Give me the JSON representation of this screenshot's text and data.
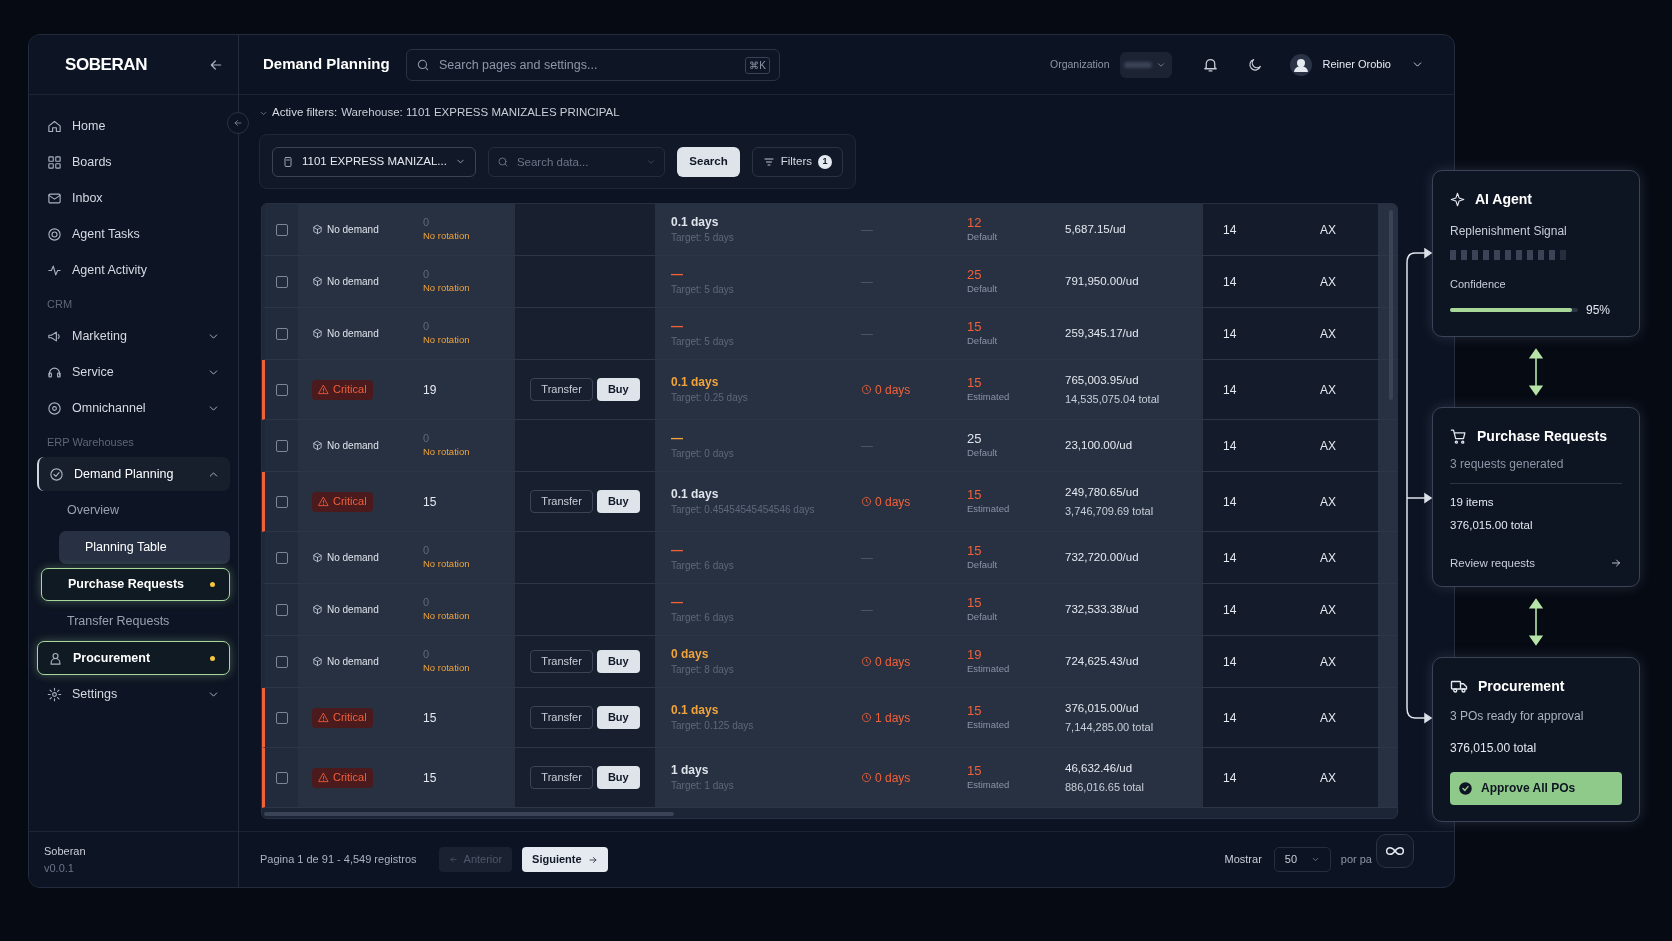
{
  "sidebar": {
    "logo": "SOBERAN",
    "nav": [
      {
        "kind": "item",
        "label": "Home",
        "selected": false,
        "active": false,
        "highlighted": false
      },
      {
        "kind": "item",
        "label": "Boards",
        "selected": false,
        "active": false,
        "highlighted": false
      },
      {
        "kind": "item",
        "label": "Inbox",
        "selected": false,
        "active": false,
        "highlighted": false
      },
      {
        "kind": "item",
        "label": "Agent Tasks",
        "selected": false,
        "active": false,
        "highlighted": false
      },
      {
        "kind": "item",
        "label": "Agent Activity",
        "selected": false,
        "active": false,
        "highlighted": false
      },
      {
        "kind": "section",
        "label": "CRM"
      },
      {
        "kind": "item",
        "label": "Marketing",
        "selected": false,
        "active": false,
        "highlighted": false,
        "expanded": false
      },
      {
        "kind": "item",
        "label": "Service",
        "selected": false,
        "active": false,
        "highlighted": false,
        "expanded": false
      },
      {
        "kind": "item",
        "label": "Omnichannel",
        "selected": false,
        "active": false,
        "highlighted": false,
        "expanded": false
      },
      {
        "kind": "section",
        "label": "ERP Warehouses"
      },
      {
        "kind": "item",
        "label": "Demand Planning",
        "selected": false,
        "active": true,
        "highlighted": false,
        "expanded": true
      },
      {
        "kind": "subitem",
        "label": "Overview",
        "selected": false,
        "active": false,
        "highlighted": false
      },
      {
        "kind": "subitem",
        "label": "Planning Table",
        "selected": true,
        "active": false,
        "highlighted": false
      },
      {
        "kind": "subitem",
        "label": "Purchase Requests",
        "selected": false,
        "active": false,
        "highlighted": true
      },
      {
        "kind": "subitem",
        "label": "Transfer Requests",
        "selected": false,
        "active": false,
        "highlighted": false
      },
      {
        "kind": "item",
        "label": "Procurement",
        "selected": false,
        "active": false,
        "highlighted": true
      },
      {
        "kind": "item",
        "label": "Settings",
        "selected": false,
        "active": false,
        "highlighted": false,
        "expanded": false
      }
    ],
    "footer": {
      "name": "Soberan",
      "version": "v0.0.1"
    }
  },
  "header": {
    "title": "Demand Planning",
    "search": {
      "placeholder": "Search pages and settings...",
      "shortcut": "⌘K"
    },
    "organization_label": "Organization",
    "user": {
      "name": "Reiner Orobio"
    }
  },
  "active_filters": {
    "label": "Active filters:",
    "value": "Warehouse: 1101 EXPRESS MANIZALES PRINCIPAL"
  },
  "toolbar": {
    "warehouse": "1101 EXPRESS MANIZAL...",
    "search": {
      "placeholder": "Search data..."
    },
    "search_button": "Search",
    "filters_button": "Filters",
    "filter_count": "1"
  },
  "table": {
    "rows": [
      {
        "kind": "no_demand",
        "checked": false,
        "status_label": "No demand",
        "stock": "0",
        "stock_note": "No rotation",
        "coverage": {
          "text": "0.1 days",
          "color": "#dfe3ea"
        },
        "target": "Target: 5 days",
        "lead": "—",
        "lead_alert": false,
        "quantity": {
          "text": "12",
          "color": "#f0613a"
        },
        "qty_basis": "Default",
        "price": "5,687.15/ud",
        "column_9": "14",
        "column_10": "AX"
      },
      {
        "kind": "no_demand",
        "checked": false,
        "status_label": "No demand",
        "stock": "0",
        "stock_note": "No rotation",
        "coverage": {
          "text": "—",
          "color": "#f0613a"
        },
        "target": "Target: 5 days",
        "lead": "—",
        "lead_alert": false,
        "quantity": {
          "text": "25",
          "color": "#f0613a"
        },
        "qty_basis": "Default",
        "price": "791,950.00/ud",
        "column_9": "14",
        "column_10": "AX"
      },
      {
        "kind": "no_demand",
        "checked": false,
        "status_label": "No demand",
        "stock": "0",
        "stock_note": "No rotation",
        "coverage": {
          "text": "—",
          "color": "#f0613a"
        },
        "target": "Target: 5 days",
        "lead": "—",
        "lead_alert": false,
        "quantity": {
          "text": "15",
          "color": "#f0613a"
        },
        "qty_basis": "Default",
        "price": "259,345.17/ud",
        "column_9": "14",
        "column_10": "AX"
      },
      {
        "kind": "critical",
        "checked": false,
        "status_label": "Critical",
        "stock": "19",
        "transfer": "Transfer",
        "buy": "Buy",
        "coverage": {
          "text": "0.1 days",
          "color": "#f2a33a"
        },
        "target": "Target: 0.25 days",
        "lead": "0 days",
        "lead_alert": true,
        "quantity": {
          "text": "15",
          "color": "#f0613a"
        },
        "qty_basis": "Estimated",
        "price": "765,003.95/ud",
        "total": "14,535,075.04 total",
        "column_9": "14",
        "column_10": "AX"
      },
      {
        "kind": "no_demand",
        "checked": false,
        "status_label": "No demand",
        "stock": "0",
        "stock_note": "No rotation",
        "coverage": {
          "text": "—",
          "color": "#f2a33a"
        },
        "target": "Target: 0 days",
        "lead": "—",
        "lead_alert": false,
        "quantity": {
          "text": "25",
          "color": "#dfe3ea"
        },
        "qty_basis": "Default",
        "price": "23,100.00/ud",
        "column_9": "14",
        "column_10": "AX"
      },
      {
        "kind": "critical",
        "checked": false,
        "status_label": "Critical",
        "stock": "15",
        "transfer": "Transfer",
        "buy": "Buy",
        "coverage": {
          "text": "0.1 days",
          "color": "#dfe3ea"
        },
        "target": "Target: 0.45454545454546 days",
        "lead": "0 days",
        "lead_alert": true,
        "quantity": {
          "text": "15",
          "color": "#f0613a"
        },
        "qty_basis": "Estimated",
        "price": "249,780.65/ud",
        "total": "3,746,709.69 total",
        "column_9": "14",
        "column_10": "AX"
      },
      {
        "kind": "no_demand",
        "checked": false,
        "status_label": "No demand",
        "stock": "0",
        "stock_note": "No rotation",
        "coverage": {
          "text": "—",
          "color": "#f0613a"
        },
        "target": "Target: 6 days",
        "lead": "—",
        "lead_alert": false,
        "quantity": {
          "text": "15",
          "color": "#f0613a"
        },
        "qty_basis": "Default",
        "price": "732,720.00/ud",
        "column_9": "14",
        "column_10": "AX"
      },
      {
        "kind": "no_demand",
        "checked": false,
        "status_label": "No demand",
        "stock": "0",
        "stock_note": "No rotation",
        "coverage": {
          "text": "—",
          "color": "#f0613a"
        },
        "target": "Target: 6 days",
        "lead": "—",
        "lead_alert": false,
        "quantity": {
          "text": "15",
          "color": "#f0613a"
        },
        "qty_basis": "Default",
        "price": "732,533.38/ud",
        "column_9": "14",
        "column_10": "AX"
      },
      {
        "kind": "no_demand",
        "checked": false,
        "status_label": "No demand",
        "stock": "0",
        "stock_note": "No rotation",
        "transfer": "Transfer",
        "buy": "Buy",
        "coverage": {
          "text": "0 days",
          "color": "#f2a33a"
        },
        "target": "Target: 8 days",
        "lead": "0 days",
        "lead_alert": true,
        "quantity": {
          "text": "19",
          "color": "#f0613a"
        },
        "qty_basis": "Estimated",
        "price": "724,625.43/ud",
        "column_9": "14",
        "column_10": "AX"
      },
      {
        "kind": "critical",
        "checked": false,
        "status_label": "Critical",
        "stock": "15",
        "transfer": "Transfer",
        "buy": "Buy",
        "coverage": {
          "text": "0.1 days",
          "color": "#f2a33a"
        },
        "target": "Target: 0.125 days",
        "lead": "1 days",
        "lead_alert": true,
        "quantity": {
          "text": "15",
          "color": "#f0613a"
        },
        "qty_basis": "Estimated",
        "price": "376,015.00/ud",
        "total": "7,144,285.00 total",
        "column_9": "14",
        "column_10": "AX"
      },
      {
        "kind": "critical",
        "checked": false,
        "status_label": "Critical",
        "stock": "15",
        "transfer": "Transfer",
        "buy": "Buy",
        "coverage": {
          "text": "1 days",
          "color": "#dfe3ea"
        },
        "target": "Target: 1 days",
        "lead": "0 days",
        "lead_alert": true,
        "quantity": {
          "text": "15",
          "color": "#f0613a"
        },
        "qty_basis": "Estimated",
        "price": "46,632.46/ud",
        "total": "886,016.65 total",
        "column_9": "14",
        "column_10": "AX"
      }
    ]
  },
  "pagination": {
    "summary": "Pagina 1 de 91 - 4,549 registros",
    "previous": {
      "label": "Anterior",
      "disabled": true
    },
    "next": {
      "label": "Siguiente",
      "disabled": false
    },
    "show_label": "Mostrar",
    "page_size": "50",
    "per_page": "por pa"
  },
  "flow": {
    "agent": {
      "title": "AI Agent",
      "signal_label": "Replenishment Signal",
      "confidence_label": "Confidence",
      "confidence": {
        "level": 0.95
      },
      "confidence_reading": "95%"
    },
    "purchase_requests": {
      "title": "Purchase Requests",
      "subtitle": "3 requests generated",
      "items": "19 items",
      "total": "376,015.00 total",
      "link": "Review requests"
    },
    "procurement": {
      "title": "Procurement",
      "subtitle": "3 POs ready for approval",
      "total": "376,015.00 total",
      "button": "Approve All POs"
    }
  }
}
